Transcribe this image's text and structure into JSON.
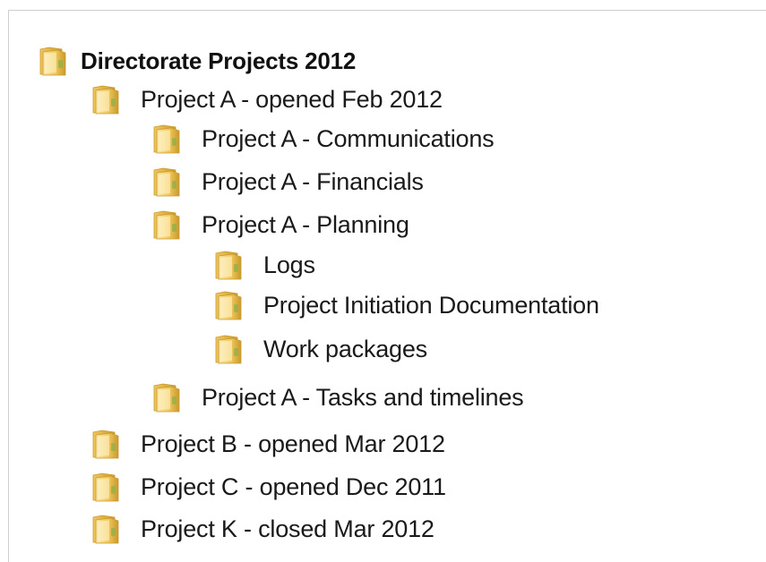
{
  "tree": {
    "root": {
      "label": "Directorate Projects 2012",
      "icon": "folder-icon"
    },
    "project_a": {
      "label": "Project A - opened Feb 2012",
      "icon": "folder-icon"
    },
    "project_a_communications": {
      "label": "Project A - Communications",
      "icon": "folder-icon"
    },
    "project_a_financials": {
      "label": "Project A - Financials",
      "icon": "folder-icon"
    },
    "project_a_planning": {
      "label": "Project A - Planning",
      "icon": "folder-icon"
    },
    "logs": {
      "label": "Logs",
      "icon": "folder-icon"
    },
    "project_initiation_documentation": {
      "label": "Project Initiation Documentation",
      "icon": "folder-icon"
    },
    "work_packages": {
      "label": "Work packages",
      "icon": "folder-icon"
    },
    "project_a_tasks_and_timelines": {
      "label": "Project A - Tasks and timelines",
      "icon": "folder-icon"
    },
    "project_b": {
      "label": "Project B - opened Mar 2012",
      "icon": "folder-icon"
    },
    "project_c": {
      "label": "Project C - opened Dec 2011",
      "icon": "folder-icon"
    },
    "project_k": {
      "label": "Project K - closed Mar 2012",
      "icon": "folder-icon"
    }
  },
  "colors": {
    "folder_light": "#fbe6a6",
    "folder_mid": "#f1c85c",
    "folder_dark": "#c99a2e",
    "text": "#1a1a1a"
  }
}
